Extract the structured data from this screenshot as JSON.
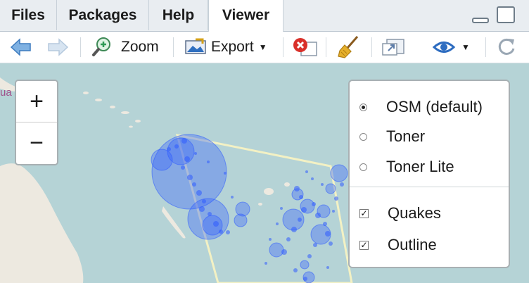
{
  "tabs": [
    {
      "label": "Files"
    },
    {
      "label": "Packages"
    },
    {
      "label": "Help"
    },
    {
      "label": "Viewer",
      "active": true
    }
  ],
  "toolbar": {
    "zoom_label": "Zoom",
    "export_label": "Export",
    "icons": [
      "back-arrow-icon",
      "forward-arrow-icon",
      "zoom-icon",
      "export-icon",
      "remove-icon",
      "broom-icon",
      "show-in-window-icon",
      "sync-icon",
      "refresh-icon"
    ]
  },
  "map": {
    "place_label": "ua  ni",
    "zoom_in_label": "+",
    "zoom_out_label": "−",
    "colors": {
      "water": "#b5d3d6",
      "land": "#ede9e0",
      "marker": "#2f5bff",
      "outline": "#f3f1c4"
    }
  },
  "layers": {
    "base": [
      {
        "label": "OSM (default)",
        "selected": true
      },
      {
        "label": "Toner",
        "selected": false
      },
      {
        "label": "Toner Lite",
        "selected": false
      }
    ],
    "overlays": [
      {
        "label": "Quakes",
        "checked": true
      },
      {
        "label": "Outline",
        "checked": true
      }
    ]
  }
}
